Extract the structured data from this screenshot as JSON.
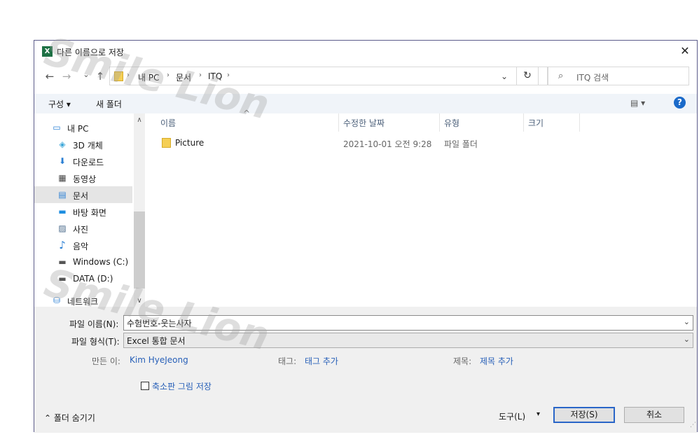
{
  "window": {
    "title": "다른 이름으로 저장",
    "app_icon": "X",
    "close_glyph": "✕"
  },
  "nav": {
    "back": "←",
    "forward": "→",
    "recent": "⌄",
    "up": "↑"
  },
  "address": {
    "crumbs": [
      "내 PC",
      "문서",
      "ITQ"
    ],
    "separator": "›",
    "dropdown": "⌄",
    "refresh": "↻"
  },
  "search": {
    "placeholder": "ITQ 검색",
    "icon": "⌕"
  },
  "toolbar": {
    "organize": "구성 ▾",
    "new_folder": "새 폴더",
    "view": "▤ ▾",
    "help": "?"
  },
  "sidebar": {
    "items": [
      {
        "label": "내 PC",
        "icon": "computer-icon",
        "glyph": "▭"
      },
      {
        "label": "3D 개체",
        "icon": "cube-icon",
        "glyph": "◈"
      },
      {
        "label": "다운로드",
        "icon": "download-icon",
        "glyph": "⬇"
      },
      {
        "label": "동영상",
        "icon": "video-icon",
        "glyph": "▦"
      },
      {
        "label": "문서",
        "icon": "document-icon",
        "glyph": "▤"
      },
      {
        "label": "바탕 화면",
        "icon": "desktop-icon",
        "glyph": "▬"
      },
      {
        "label": "사진",
        "icon": "picture-icon",
        "glyph": "▨"
      },
      {
        "label": "음악",
        "icon": "music-icon",
        "glyph": "♪"
      },
      {
        "label": "Windows (C:)",
        "icon": "drive-c-icon",
        "glyph": "▬"
      },
      {
        "label": "DATA (D:)",
        "icon": "drive-d-icon",
        "glyph": "▬"
      },
      {
        "label": "네트워크",
        "icon": "network-icon",
        "glyph": "⛁"
      }
    ],
    "selected_index": 4
  },
  "columns": {
    "name": "이름",
    "modified": "수정한 날짜",
    "type": "유형",
    "size": "크기",
    "sort_glyph": "^"
  },
  "files": [
    {
      "name": "Picture",
      "modified": "2021-10-01 오전 9:28",
      "type": "파일 폴더",
      "size": ""
    }
  ],
  "form": {
    "filename_label": "파일 이름(N):",
    "filename_value": "수험번호-웃는사자",
    "filetype_label": "파일 형식(T):",
    "filetype_value": "Excel 통합 문서",
    "author_label": "만든 이:",
    "author_value": "Kim HyeJeong",
    "tags_label": "태그:",
    "tags_value": "태그 추가",
    "title_label": "제목:",
    "title_value": "제목 추가",
    "thumbnail_label": "축소판 그림 저장",
    "dropdown_glyph": "⌄"
  },
  "footer": {
    "hide_folders": "⌃ 폴더 숨기기",
    "tools": "도구(L)",
    "tools_arrow": "▾",
    "save": "저장(S)",
    "cancel": "취소"
  },
  "watermark": {
    "text1": "Smile Lion",
    "text2": "Smile Lion"
  },
  "colors": {
    "accent": "#2a66c8",
    "excel": "#1e7145",
    "link": "#2860b8",
    "help": "#1b6ac9"
  }
}
